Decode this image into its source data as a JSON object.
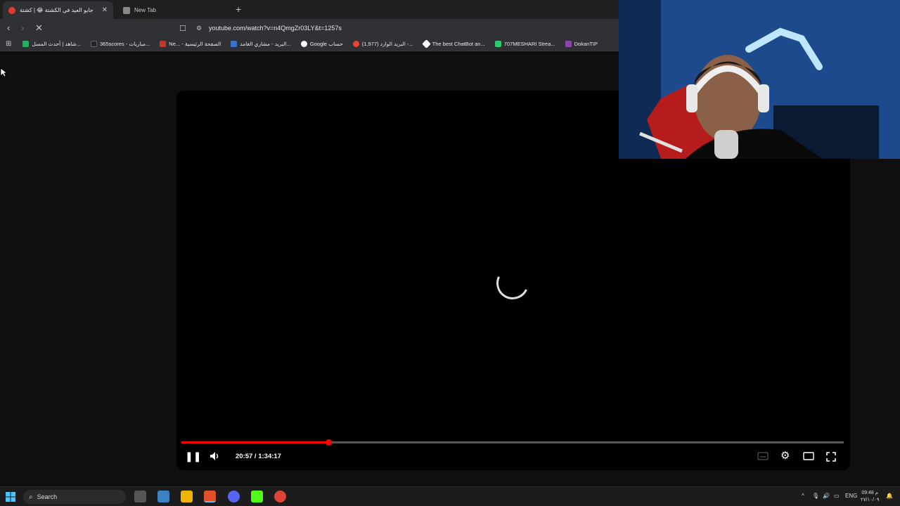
{
  "browser": {
    "tabs": [
      {
        "title": "جايو العيد في الكشتة 😂 | كشتة",
        "active": true
      },
      {
        "title": "New Tab",
        "active": false
      }
    ],
    "new_tab_symbol": "+",
    "url": "youtube.com/watch?v=n4QmgZr03LY&t=1257s",
    "bookmarks": [
      {
        "label": "شاهد | أحدث المسل...",
        "color": "#27ae60"
      },
      {
        "label": "365scores - مباريات...",
        "color": "#222222"
      },
      {
        "label": "Ne... - الصفحة الرئيسية",
        "color": "#c0392b"
      },
      {
        "label": "البريد - مشاري الغامد...",
        "color": "#3b73c8"
      },
      {
        "label": "Google حساب",
        "color": "#ffffff"
      },
      {
        "label": "(1,977) البريد الوارد -...",
        "color": "#ea4335"
      },
      {
        "label": "The best ChatBot an...",
        "color": "#ffffff"
      },
      {
        "label": "707MESHARI Strea...",
        "color": "#2ecc71"
      },
      {
        "label": "DokanTIP",
        "color": "#8e44ad"
      }
    ]
  },
  "player": {
    "current_time": "20:57",
    "duration": "1:34:17",
    "time_display": "20:57 / 1:34:17",
    "progress_fraction": 0.222,
    "state": "loading",
    "accent": "#ff0000"
  },
  "taskbar": {
    "search_placeholder": "Search",
    "language": "ENG",
    "time": "09:48 م",
    "date": "٢٧/١٠/٠٩"
  }
}
